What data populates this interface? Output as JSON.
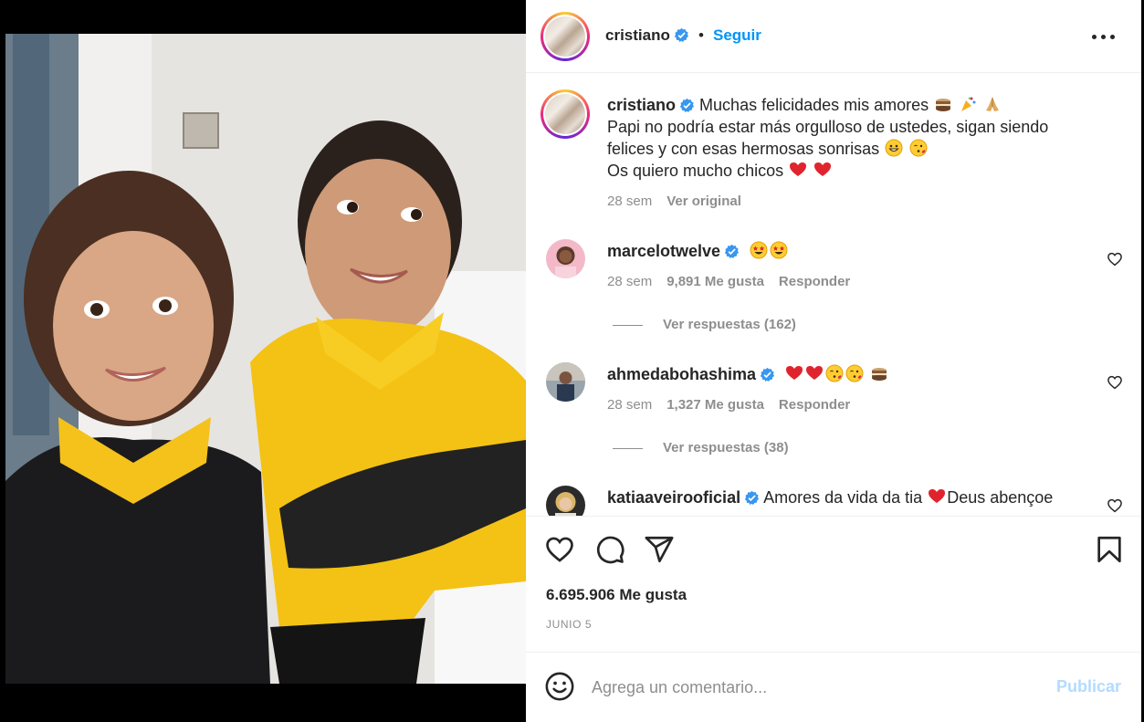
{
  "post": {
    "username": "cristiano",
    "dot": "•",
    "follow_label": "Seguir",
    "more_icon": "more-options-icon"
  },
  "caption": {
    "username": "cristiano",
    "line1": "Muchas felicidades mis amores",
    "line2": "Papi no podría estar más orgulloso de ustedes, sigan siendo",
    "line3": "felices y con esas hermosas sonrisas",
    "line4": "Os quiero mucho chicos",
    "time": "28 sem",
    "see_original": "Ver original",
    "emojis": [
      "cake-emoji",
      "party-popper-emoji",
      "folded-hands-emoji",
      "grinning-face-emoji",
      "face-blowing-kiss-emoji",
      "red-heart-emoji",
      "red-heart-emoji"
    ]
  },
  "comments": [
    {
      "username": "marcelotwelve",
      "text": "",
      "emojis": [
        "star-struck-emoji",
        "star-struck-emoji"
      ],
      "time": "28 sem",
      "likes": "9,891 Me gusta",
      "reply": "Responder",
      "view_replies": "Ver respuestas (162)"
    },
    {
      "username": "ahmedabohashima",
      "text": "",
      "emojis": [
        "red-heart-emoji",
        "red-heart-emoji",
        "face-blowing-kiss-emoji",
        "face-blowing-kiss-emoji",
        "cake-emoji"
      ],
      "time": "28 sem",
      "likes": "1,327 Me gusta",
      "reply": "Responder",
      "view_replies": "Ver respuestas (38)"
    },
    {
      "username": "katiaaveirooficial",
      "text_before": "Amores da vida da tia",
      "text_after": "Deus abençoe",
      "emojis": [
        "red-heart-emoji"
      ]
    }
  ],
  "actions": {
    "likes": "6.695.906 Me gusta",
    "date": "JUNIO 5"
  },
  "composer": {
    "placeholder": "Agrega un comentario...",
    "publish_label": "Publicar"
  },
  "colors": {
    "accent": "#0095f6",
    "muted": "#8e8e8e",
    "publish_disabled": "#b3dbff",
    "heart": "#e0245e"
  }
}
